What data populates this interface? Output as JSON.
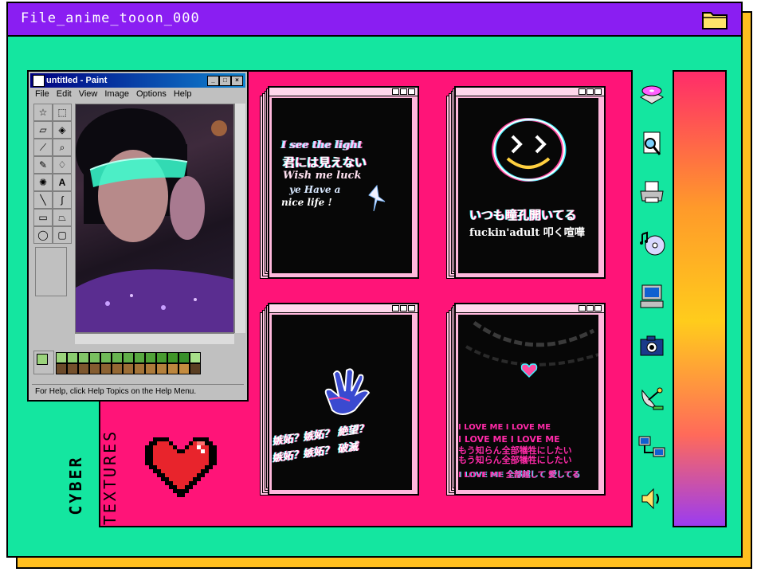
{
  "window": {
    "title": "File_anime_tooon_000"
  },
  "paint": {
    "title": "untitled - Paint",
    "menu": [
      "File",
      "Edit",
      "View",
      "Image",
      "Options",
      "Help"
    ],
    "status": "For Help, click Help Topics on the Help Menu."
  },
  "panels": [
    {
      "lines": [
        "I see the light",
        "君には見えない",
        "Wish me luck",
        "ye Have a",
        "nice life !"
      ]
    },
    {
      "lines": [
        "いつも瞳孔開いてる",
        "fuckin'adult 叩く喧嘩"
      ]
    },
    {
      "lines": [
        "嫉妬？嫉妬？ 絶望？",
        "嫉妬？嫉妬？ 破滅"
      ]
    },
    {
      "lines": [
        "I LOVE ME   I LOVE ME",
        "I LOVE ME   I LOVE ME",
        "もう知らん全部犠牲にしたい",
        "もう知らん全部犠牲にしたい",
        "I LOVE ME  全部越して 愛してる"
      ]
    }
  ],
  "side_label": {
    "line1": "CYBER",
    "line2": "TEXTURES"
  },
  "icons": [
    "disc-drive-icon",
    "search-document-icon",
    "printer-icon",
    "music-cd-icon",
    "computer-icon",
    "camera-icon",
    "satellite-dish-icon",
    "network-icon",
    "speaker-icon"
  ],
  "colors": {
    "titlebar": "#8a1ef2",
    "background": "#14e6a0",
    "pink": "#ff1478",
    "shadow": "#ffbf1f"
  }
}
